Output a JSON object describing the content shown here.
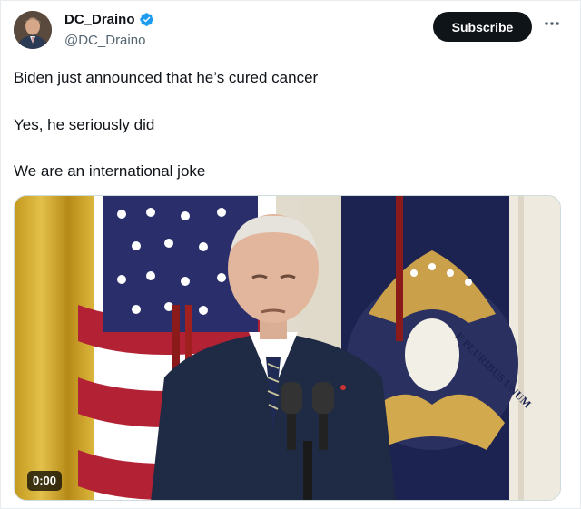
{
  "author": {
    "display_name": "DC_Draino",
    "handle": "@DC_Draino",
    "verified": true,
    "avatar_icon": "profile-photo"
  },
  "actions": {
    "subscribe_label": "Subscribe",
    "more_icon": "more-horizontal-icon"
  },
  "post": {
    "lines": [
      "Biden just announced that he’s cured cancer",
      "Yes, he seriously did",
      "We are an international joke"
    ]
  },
  "media": {
    "type": "video",
    "timestamp": "0:00",
    "seal_text": "E PLURIBUS UNUM"
  },
  "colors": {
    "verified_blue": "#1d9bf0",
    "subscribe_bg": "#0f1419",
    "handle_gray": "#536471"
  }
}
